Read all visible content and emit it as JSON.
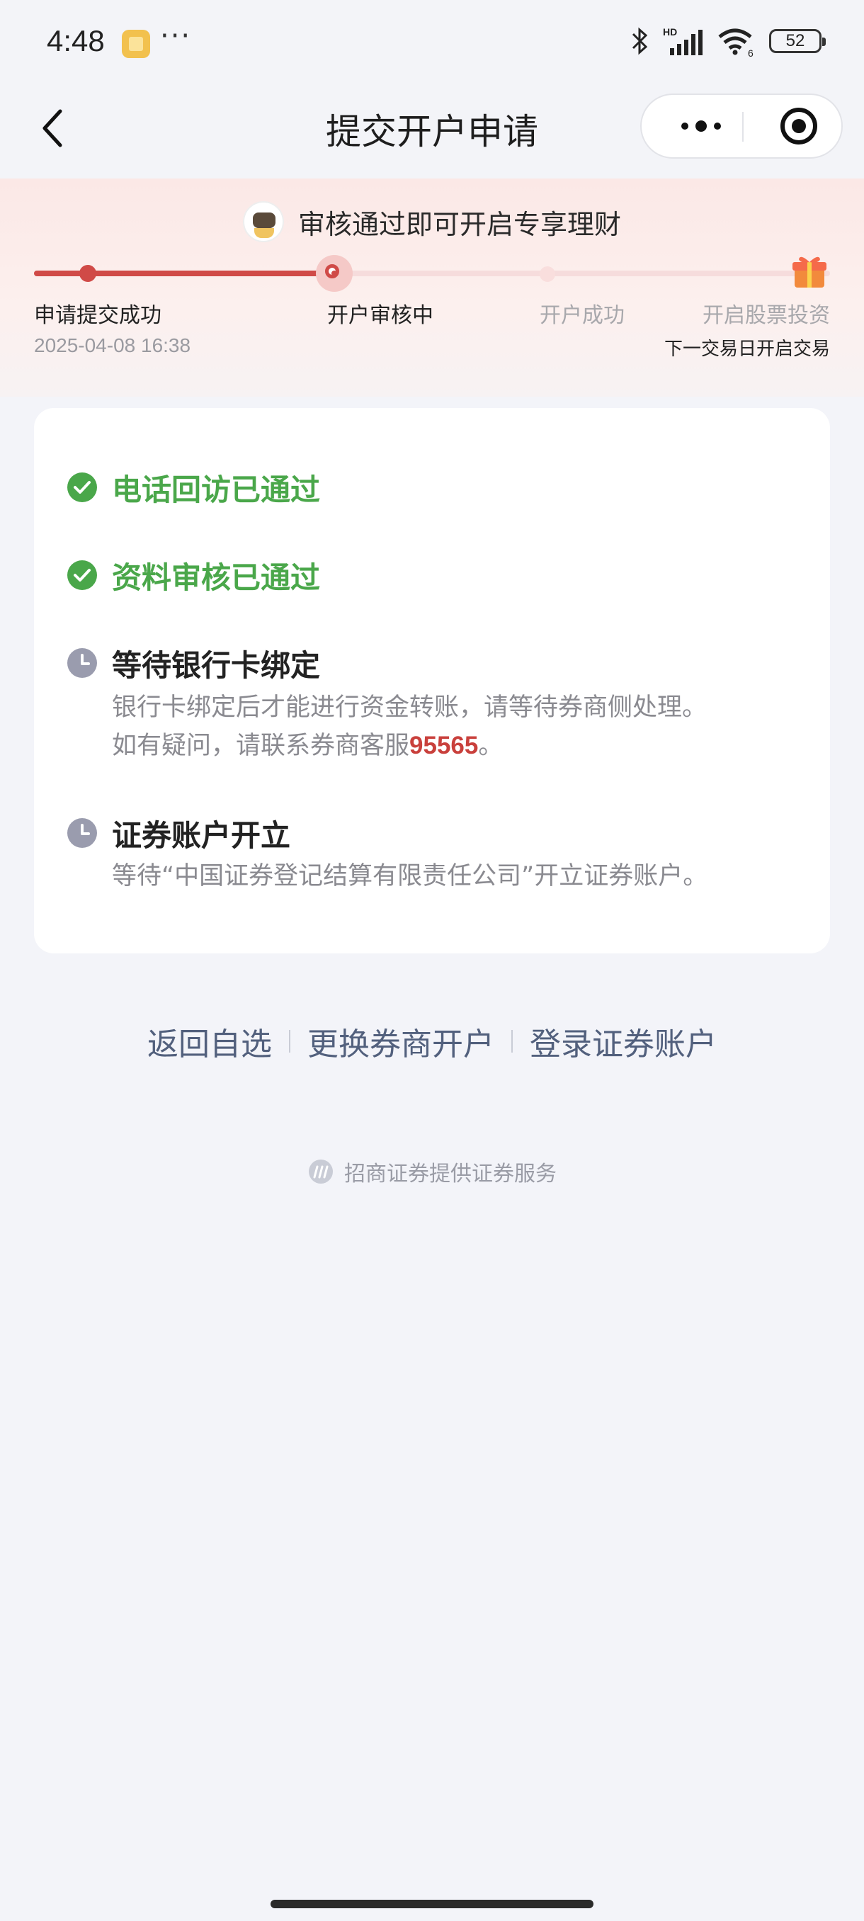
{
  "status_bar": {
    "time": "4:48",
    "dots": "···",
    "battery": "52",
    "icons": [
      "app-notification-icon",
      "bluetooth-icon",
      "signal-icon",
      "wifi-icon",
      "battery-icon"
    ]
  },
  "nav": {
    "title": "提交开户申请",
    "back_icon": "chevron-left-icon",
    "more_icon": "more-icon",
    "close_icon": "target-close-icon"
  },
  "progress": {
    "promo_text": "审核通过即可开启专享理财",
    "steps": [
      {
        "label": "申请提交成功",
        "sub": "2025-04-08 16:38",
        "state": "done"
      },
      {
        "label": "开户审核中",
        "sub": "",
        "state": "current"
      },
      {
        "label": "开户成功",
        "sub": "",
        "state": "pending"
      },
      {
        "label": "开启股票投资",
        "sub": "下一交易日开启交易",
        "state": "pending"
      }
    ],
    "fill_fraction": 0.375,
    "active_color": "#d04a47"
  },
  "checklist": {
    "items": [
      {
        "title": "电话回访已通过",
        "status": "done"
      },
      {
        "title": "资料审核已通过",
        "status": "done"
      },
      {
        "title": "等待银行卡绑定",
        "status": "waiting",
        "desc_line1": "银行卡绑定后才能进行资金转账，请等待券商侧处理。",
        "desc_line2_prefix": "如有疑问，请联系券商客服",
        "hotline": "95565",
        "desc_line2_suffix": "。"
      },
      {
        "title": "证券账户开立",
        "status": "waiting",
        "desc_line1": "等待“中国证券登记结算有限责任公司”开立证券账户。"
      }
    ],
    "done_color": "#4aa74a",
    "waiting_color": "#9a9cae"
  },
  "links": {
    "back_to_watchlist": "返回自选",
    "change_broker": "更换券商开户",
    "login_account": "登录证券账户"
  },
  "footer": {
    "text": "招商证券提供证券服务"
  }
}
